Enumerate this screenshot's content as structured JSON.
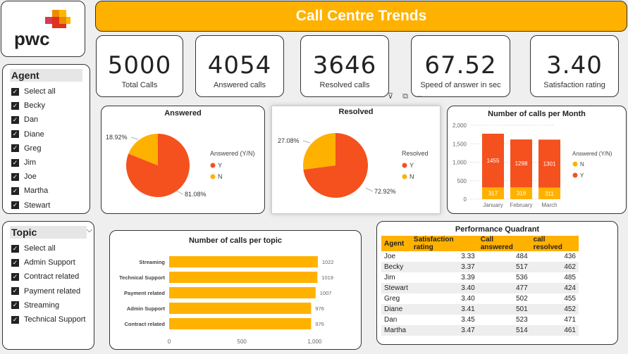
{
  "header": {
    "title": "Call Centre Trends"
  },
  "logo": {
    "text": "pwc",
    "colors": [
      "#d93954",
      "#e0301e",
      "#eb8c00",
      "#ffb600"
    ]
  },
  "kpis": [
    {
      "value": "5000",
      "label": "Total Calls"
    },
    {
      "value": "4054",
      "label": "Answered calls"
    },
    {
      "value": "3646",
      "label": "Resolved calls"
    },
    {
      "value": "67.52",
      "label": "Speed of answer in sec"
    },
    {
      "value": "3.40",
      "label": "Satisfaction rating"
    }
  ],
  "agent_slicer": {
    "title": "Agent",
    "items": [
      "Select all",
      "Becky",
      "Dan",
      "Diane",
      "Greg",
      "Jim",
      "Joe",
      "Martha",
      "Stewart"
    ]
  },
  "topic_slicer": {
    "title": "Topic",
    "items": [
      "Select all",
      "Admin Support",
      "Contract related",
      "Payment related",
      "Streaming",
      "Technical Support"
    ]
  },
  "colors": {
    "accent": "#ffb100",
    "red": "#f4511e",
    "yellow": "#ffb100"
  },
  "chart_data": [
    {
      "type": "pie",
      "title": "Answered",
      "legend_title": "Answered (Y/N)",
      "legend": [
        "Y",
        "N"
      ],
      "slices": [
        {
          "name": "Y",
          "value": 81.08,
          "label": "81.08%"
        },
        {
          "name": "N",
          "value": 18.92,
          "label": "18.92%"
        }
      ]
    },
    {
      "type": "pie",
      "title": "Resolved",
      "legend_title": "Resolved",
      "legend": [
        "Y",
        "N"
      ],
      "slices": [
        {
          "name": "Y",
          "value": 72.92,
          "label": "72.92%"
        },
        {
          "name": "N",
          "value": 27.08,
          "label": "27.08%"
        }
      ]
    },
    {
      "type": "bar",
      "stacked": true,
      "title": "Number of calls per Month",
      "categories": [
        "January",
        "February",
        "March"
      ],
      "legend_title": "Answered (Y/N)",
      "legend": [
        "N",
        "Y"
      ],
      "series": [
        {
          "name": "Y",
          "values": [
            1455,
            1298,
            1301
          ]
        },
        {
          "name": "N",
          "values": [
            317,
            318,
            311
          ]
        }
      ],
      "yticks": [
        "0",
        "500",
        "1,000",
        "1,500",
        "2,000"
      ],
      "ylim": [
        0,
        2000
      ]
    },
    {
      "type": "bar",
      "orientation": "horizontal",
      "title": "Number of calls per topic",
      "categories": [
        "Streaming",
        "Technical Support",
        "Payment related",
        "Admin Support",
        "Contract related"
      ],
      "values": [
        1022,
        1019,
        1007,
        976,
        976
      ],
      "xticks": [
        "0",
        "500",
        "1,000"
      ],
      "xlim": [
        0,
        1100
      ]
    }
  ],
  "quadrant": {
    "title": "Performance Quadrant",
    "columns": [
      "Agent",
      "Satisfaction rating",
      "Call answered",
      "call resolved"
    ],
    "rows": [
      [
        "Joe",
        "3.33",
        "484",
        "436"
      ],
      [
        "Becky",
        "3.37",
        "517",
        "462"
      ],
      [
        "Jim",
        "3.39",
        "536",
        "485"
      ],
      [
        "Stewart",
        "3.40",
        "477",
        "424"
      ],
      [
        "Greg",
        "3.40",
        "502",
        "455"
      ],
      [
        "Diane",
        "3.41",
        "501",
        "452"
      ],
      [
        "Dan",
        "3.45",
        "523",
        "471"
      ],
      [
        "Martha",
        "3.47",
        "514",
        "461"
      ]
    ]
  }
}
